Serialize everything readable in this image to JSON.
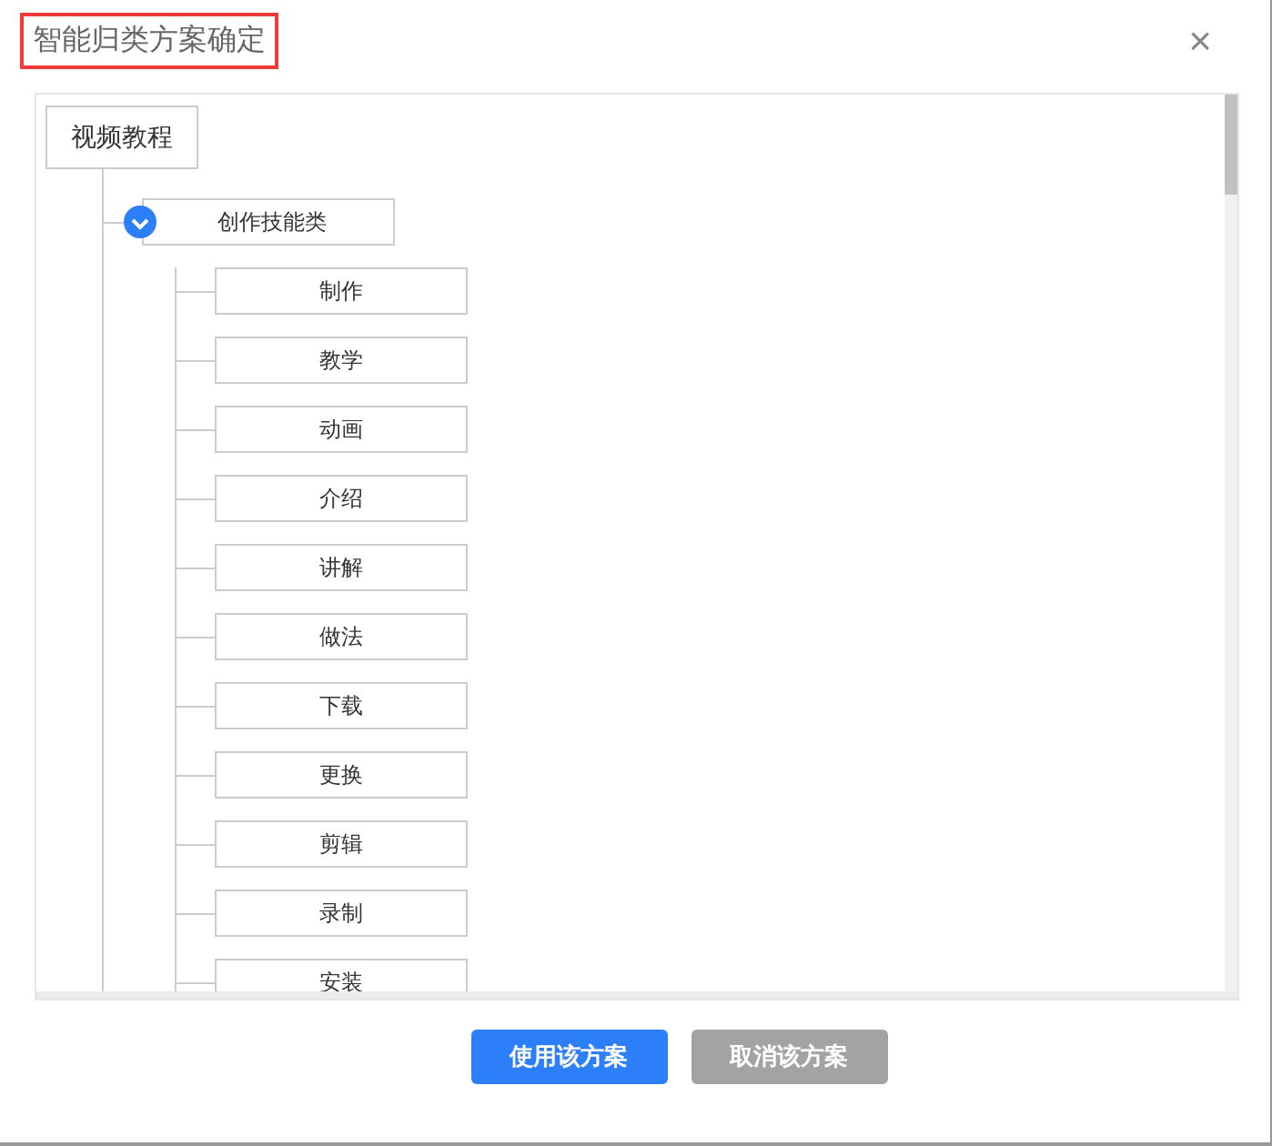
{
  "dialog": {
    "title": "智能归类方案确定",
    "close": "×"
  },
  "tree": {
    "label": "视频教程",
    "children": [
      {
        "label": "创作技能类",
        "expanded": true,
        "children": [
          {
            "label": "制作"
          },
          {
            "label": "教学"
          },
          {
            "label": "动画"
          },
          {
            "label": "介绍"
          },
          {
            "label": "讲解"
          },
          {
            "label": "做法"
          },
          {
            "label": "下载"
          },
          {
            "label": "更换"
          },
          {
            "label": "剪辑"
          },
          {
            "label": "录制"
          },
          {
            "label": "安装"
          }
        ]
      }
    ]
  },
  "buttons": [
    {
      "label": "使用该方案",
      "disabled": false
    },
    {
      "label": "取消该方案",
      "disabled": true
    }
  ]
}
